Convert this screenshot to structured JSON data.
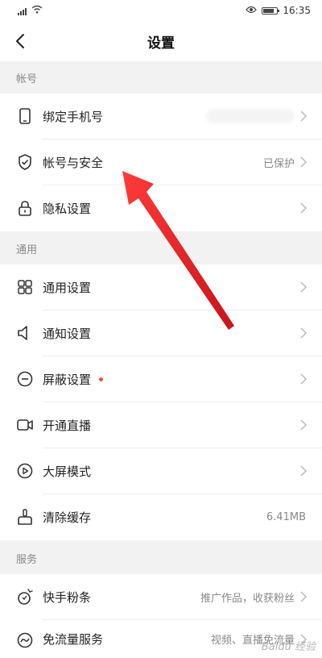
{
  "status": {
    "time": "16:35",
    "carrier_tag": "4G"
  },
  "nav": {
    "title": "设置"
  },
  "sections": {
    "account": "帐号",
    "general": "通用",
    "service": "服务"
  },
  "items": {
    "bind_phone": {
      "label": "绑定手机号"
    },
    "account_security": {
      "label": "帐号与安全",
      "value": "已保护"
    },
    "privacy": {
      "label": "隐私设置"
    },
    "general_settings": {
      "label": "通用设置"
    },
    "notification": {
      "label": "通知设置"
    },
    "block": {
      "label": "屏蔽设置"
    },
    "live": {
      "label": "开通直播"
    },
    "big_screen": {
      "label": "大屏模式"
    },
    "cache": {
      "label": "清除缓存",
      "value": "6.41MB"
    },
    "fans": {
      "label": "快手粉条",
      "value": "推广作品，收获粉丝"
    },
    "free_data": {
      "label": "免流量服务",
      "value": "视频、直播免流量"
    }
  },
  "colors": {
    "accent_red": "#e8543a",
    "arrow_red": "#e8262b"
  },
  "watermark": "Baidu 经验"
}
